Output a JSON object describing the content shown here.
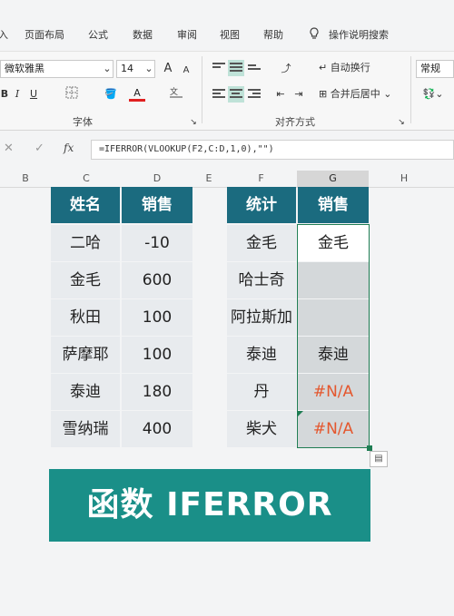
{
  "menu": {
    "items": [
      "页面布局",
      "公式",
      "数据",
      "审阅",
      "视图",
      "帮助"
    ],
    "search_label": "操作说明搜索"
  },
  "ribbon": {
    "font_name": "微软雅黑",
    "font_size": "14",
    "bold": "B",
    "italic": "I",
    "underline": "U",
    "grow_font": "A",
    "shrink_font": "A",
    "wrap_text": "自动换行",
    "merge_center": "合并后居中",
    "number_format": "常规",
    "font_group_label": "字体",
    "align_group_label": "对齐方式"
  },
  "formula_bar": {
    "cancel": "✕",
    "confirm": "✓",
    "fx": "fx",
    "formula": "=IFERROR(VLOOKUP(F2,C:D,1,0),\"\")"
  },
  "columns": [
    "B",
    "C",
    "D",
    "E",
    "F",
    "G",
    "H"
  ],
  "left_table": {
    "headers": [
      "姓名",
      "销售"
    ],
    "rows": [
      [
        "二哈",
        "-10"
      ],
      [
        "金毛",
        "600"
      ],
      [
        "秋田",
        "100"
      ],
      [
        "萨摩耶",
        "100"
      ],
      [
        "泰迪",
        "180"
      ],
      [
        "雪纳瑞",
        "400"
      ]
    ]
  },
  "right_table": {
    "headers": [
      "统计",
      "销售"
    ],
    "rows": [
      [
        "金毛",
        "金毛"
      ],
      [
        "哈士奇",
        ""
      ],
      [
        "阿拉斯加",
        ""
      ],
      [
        "泰迪",
        "泰迪"
      ],
      [
        "丹",
        "#N/A"
      ],
      [
        "柴犬",
        "#N/A"
      ]
    ]
  },
  "banner_text": "函数 IFERROR",
  "colors": {
    "header": "#1b6b7f",
    "banner": "#1a8f88",
    "error_text": "#e4572e",
    "selection": "#1e7d53"
  }
}
